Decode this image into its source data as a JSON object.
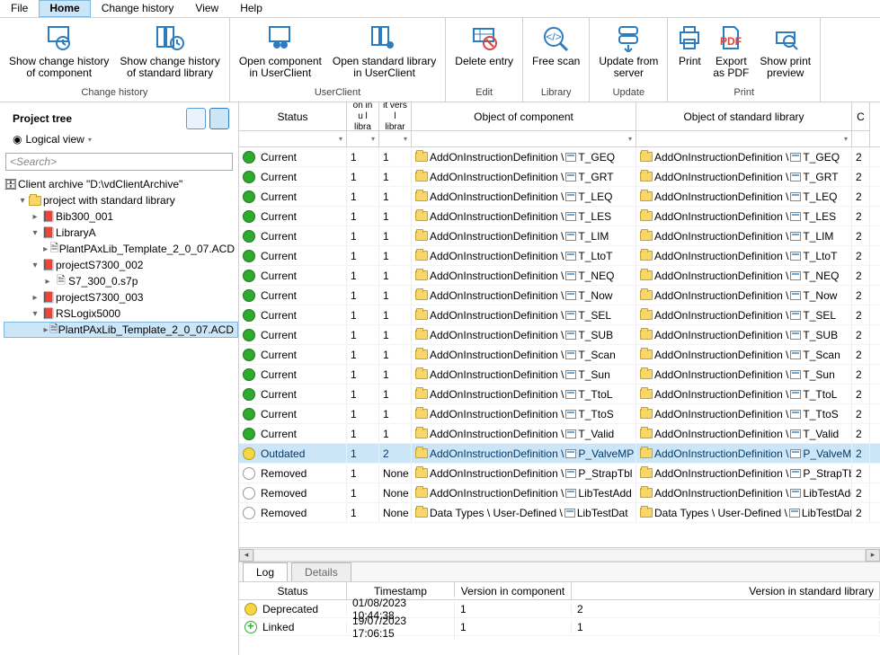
{
  "menu": {
    "file": "File",
    "home": "Home",
    "change_history": "Change history",
    "view": "View",
    "help": "Help"
  },
  "ribbon": {
    "groups": [
      {
        "label": "Change history",
        "buttons": [
          {
            "id": "show-chg-component",
            "line1": "Show change history",
            "line2": "of component"
          },
          {
            "id": "show-chg-stdlib",
            "line1": "Show change history",
            "line2": "of standard library"
          }
        ]
      },
      {
        "label": "UserClient",
        "buttons": [
          {
            "id": "open-component",
            "line1": "Open component",
            "line2": "in UserClient"
          },
          {
            "id": "open-stdlib",
            "line1": "Open standard library",
            "line2": "in UserClient"
          }
        ]
      },
      {
        "label": "Edit",
        "buttons": [
          {
            "id": "delete-entry",
            "line1": "Delete entry",
            "line2": ""
          }
        ]
      },
      {
        "label": "Library",
        "buttons": [
          {
            "id": "free-scan",
            "line1": "Free scan",
            "line2": ""
          }
        ]
      },
      {
        "label": "Update",
        "buttons": [
          {
            "id": "update-server",
            "line1": "Update from",
            "line2": "server"
          }
        ]
      },
      {
        "label": "Print",
        "buttons": [
          {
            "id": "print",
            "line1": "Print",
            "line2": ""
          },
          {
            "id": "export-pdf",
            "line1": "Export",
            "line2": "as PDF"
          },
          {
            "id": "print-preview",
            "line1": "Show print",
            "line2": "preview"
          }
        ]
      }
    ]
  },
  "project_tree": {
    "title": "Project tree",
    "logical_view": "Logical view",
    "search_placeholder": "<Search>",
    "root": "Client archive \"D:\\vdClientArchive\"",
    "items": [
      {
        "depth": 1,
        "expander": "v",
        "icon": "folder",
        "label": "project with standard library"
      },
      {
        "depth": 2,
        "expander": ">",
        "icon": "book",
        "label": "Bib300_001"
      },
      {
        "depth": 2,
        "expander": "v",
        "icon": "book",
        "label": "LibraryA"
      },
      {
        "depth": 3,
        "expander": ">",
        "icon": "file",
        "label": "PlantPAxLib_Template_2_0_07.ACD"
      },
      {
        "depth": 2,
        "expander": "v",
        "icon": "book",
        "label": "projectS7300_002"
      },
      {
        "depth": 3,
        "expander": ">",
        "icon": "file",
        "label": "S7_300_0.s7p"
      },
      {
        "depth": 2,
        "expander": ">",
        "icon": "book",
        "label": "projectS7300_003"
      },
      {
        "depth": 2,
        "expander": "v",
        "icon": "book",
        "label": "RSLogix5000"
      },
      {
        "depth": 3,
        "expander": ">",
        "icon": "file",
        "label": "PlantPAxLib_Template_2_0_07.ACD",
        "selected": true
      }
    ]
  },
  "grid": {
    "headers": {
      "status": "Status",
      "v1": "on in u\nl libra",
      "v2": "it vers\nl librar",
      "obj": "Object of component",
      "obj2": "Object of standard library",
      "last": "C"
    },
    "rows": [
      {
        "status": "Current",
        "dot": "green",
        "v1": "1",
        "v2": "1",
        "name": "T_GEQ",
        "last": "2"
      },
      {
        "status": "Current",
        "dot": "green",
        "v1": "1",
        "v2": "1",
        "name": "T_GRT",
        "last": "2"
      },
      {
        "status": "Current",
        "dot": "green",
        "v1": "1",
        "v2": "1",
        "name": "T_LEQ",
        "last": "2"
      },
      {
        "status": "Current",
        "dot": "green",
        "v1": "1",
        "v2": "1",
        "name": "T_LES",
        "last": "2"
      },
      {
        "status": "Current",
        "dot": "green",
        "v1": "1",
        "v2": "1",
        "name": "T_LIM",
        "last": "2"
      },
      {
        "status": "Current",
        "dot": "green",
        "v1": "1",
        "v2": "1",
        "name": "T_LtoT",
        "last": "2"
      },
      {
        "status": "Current",
        "dot": "green",
        "v1": "1",
        "v2": "1",
        "name": "T_NEQ",
        "last": "2"
      },
      {
        "status": "Current",
        "dot": "green",
        "v1": "1",
        "v2": "1",
        "name": "T_Now",
        "last": "2"
      },
      {
        "status": "Current",
        "dot": "green",
        "v1": "1",
        "v2": "1",
        "name": "T_SEL",
        "last": "2"
      },
      {
        "status": "Current",
        "dot": "green",
        "v1": "1",
        "v2": "1",
        "name": "T_SUB",
        "last": "2"
      },
      {
        "status": "Current",
        "dot": "green",
        "v1": "1",
        "v2": "1",
        "name": "T_Scan",
        "last": "2"
      },
      {
        "status": "Current",
        "dot": "green",
        "v1": "1",
        "v2": "1",
        "name": "T_Sun",
        "last": "2"
      },
      {
        "status": "Current",
        "dot": "green",
        "v1": "1",
        "v2": "1",
        "name": "T_TtoL",
        "last": "2"
      },
      {
        "status": "Current",
        "dot": "green",
        "v1": "1",
        "v2": "1",
        "name": "T_TtoS",
        "last": "2"
      },
      {
        "status": "Current",
        "dot": "green",
        "v1": "1",
        "v2": "1",
        "name": "T_Valid",
        "last": "2"
      },
      {
        "status": "Outdated",
        "dot": "yellow",
        "v1": "1",
        "v2": "2",
        "name": "P_ValveMP",
        "last": "2",
        "selected": true
      },
      {
        "status": "Removed",
        "dot": "grey",
        "v1": "1",
        "v2": "None",
        "name": "P_StrapTbl",
        "last": "2"
      },
      {
        "status": "Removed",
        "dot": "grey",
        "v1": "1",
        "v2": "None",
        "name": "LibTestAdd",
        "last": "2"
      },
      {
        "status": "Removed",
        "dot": "grey",
        "v1": "1",
        "v2": "None",
        "name": "LibTestDat",
        "last": "2",
        "alt_prefix": true
      }
    ],
    "prefix": "AddOnInstructionDefinition \\",
    "alt_prefix": "Data Types \\ User-Defined \\"
  },
  "log": {
    "tabs": {
      "log": "Log",
      "details": "Details"
    },
    "headers": {
      "status": "Status",
      "ts": "Timestamp",
      "vc": "Version in component",
      "vsl": "Version in standard library"
    },
    "rows": [
      {
        "dot": "yellow",
        "status": "Deprecated",
        "ts": "01/08/2023 10:44:38",
        "vc": "1",
        "vsl": "2"
      },
      {
        "dot": "plus",
        "status": "Linked",
        "ts": "19/07/2023 17:06:15",
        "vc": "1",
        "vsl": "1"
      }
    ]
  }
}
